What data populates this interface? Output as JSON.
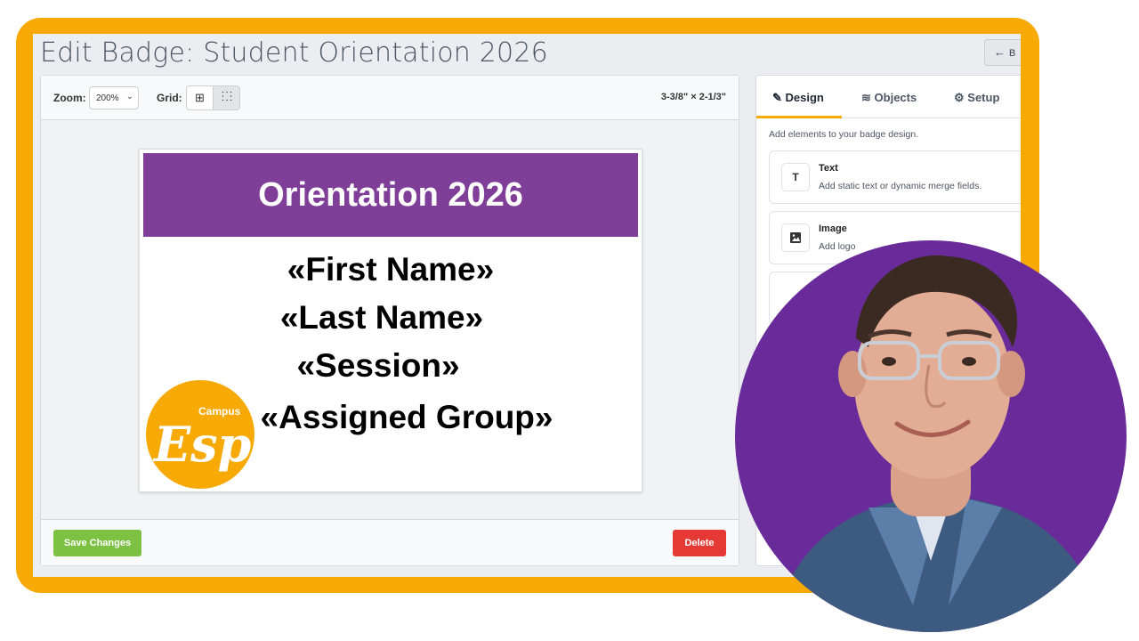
{
  "window": {
    "title": "Edit Badge: Student Orientation 2026",
    "back_button": {
      "icon": "arrow-left-icon",
      "label": "B"
    }
  },
  "toolbar": {
    "zoom_label": "Zoom:",
    "zoom_value": "200%",
    "grid_label": "Grid:",
    "grid_buttons": [
      "grid-lines-icon",
      "grid-dots-icon"
    ],
    "dimensions": "3-3/8\" × 2-1/3\""
  },
  "badge": {
    "header_text": "Orientation 2026",
    "header_color": "#7f3f98",
    "fields": [
      "«First Name»",
      "«Last Name»",
      "«Session»",
      "«Assigned Group»"
    ],
    "logo": {
      "text_small": "Campus",
      "text_large": "Esp",
      "color": "#f7a906"
    }
  },
  "footer": {
    "save_label": "Save Changes",
    "delete_label": "Delete"
  },
  "side_panel": {
    "tabs": [
      {
        "icon": "pencil-icon",
        "label": "Design"
      },
      {
        "icon": "layers-icon",
        "label": "Objects"
      },
      {
        "icon": "gear-icon",
        "label": "Setup"
      }
    ],
    "hint": "Add elements to your badge design.",
    "cards": [
      {
        "icon": "T",
        "title": "Text",
        "desc": "Add static text or dynamic merge fields."
      },
      {
        "icon": "image-icon",
        "title": "Image",
        "desc": "Add logo"
      }
    ]
  },
  "colors": {
    "accent": "#f7a906",
    "purple": "#6a2b9a",
    "save": "#7cc142",
    "delete": "#e53935"
  }
}
